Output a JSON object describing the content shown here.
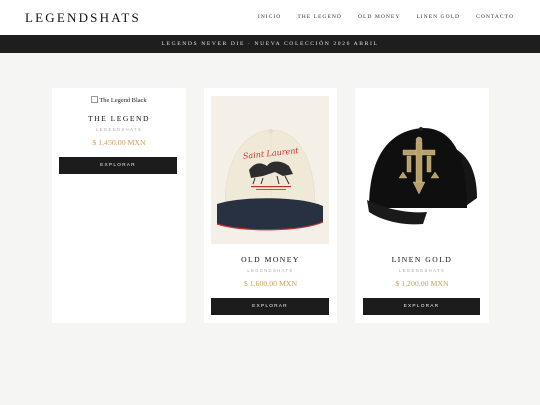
{
  "header": {
    "logo": "LEGENDSHATS"
  },
  "nav": [
    "INICIO",
    "THE LEGEND",
    "OLD MONEY",
    "LINEN GOLD",
    "CONTACTO"
  ],
  "banner": "LEGENDS NEVER DIE · NUEVA COLECCIÓN 2026 ABRIL",
  "products": [
    {
      "alt": "The Legend Black",
      "title": "THE LEGEND",
      "brand": "LEGENDSHATS",
      "price": "$ 1,450.00 MXN",
      "button": "EXPLORAR"
    },
    {
      "title": "OLD MONEY",
      "brand": "LEGENDSHATS",
      "price": "$ 1,600.00 MXN",
      "button": "EXPLORAR",
      "cap_text": "Saint Laurent"
    },
    {
      "title": "LINEN GOLD",
      "brand": "LEGENDSHATS",
      "price": "$ 1,200.00 MXN",
      "button": "EXPLORAR"
    }
  ],
  "colors": {
    "accent_price": "#c9a35c",
    "button_bg": "#1c1c1c",
    "banner_bg": "#1e1e1e"
  }
}
